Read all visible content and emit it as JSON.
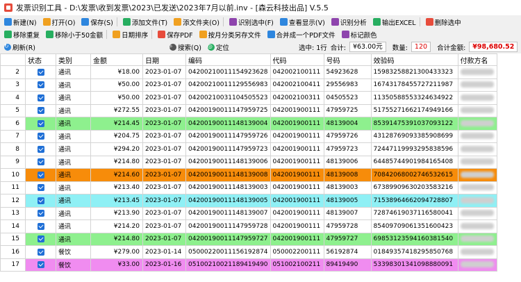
{
  "window": {
    "title": "发票识别工具 - D:\\发票\\收到发票\\2023\\已发送\\2023年7月以前.inv - [森云科技出品] V.5.5"
  },
  "toolbar1": [
    {
      "label": "新建(N)",
      "icon": "new-icon",
      "color": "#2e86de"
    },
    {
      "label": "打开(O)",
      "icon": "folder-open-icon",
      "color": "#f0a020"
    },
    {
      "label": "保存(S)",
      "icon": "save-icon",
      "color": "#2e86de"
    },
    {
      "label": "添加文件(T)",
      "icon": "add-file-icon",
      "color": "#27ae60"
    },
    {
      "label": "添文件夹(O)",
      "icon": "add-folder-icon",
      "color": "#f0a020"
    },
    {
      "label": "识别选中(F)",
      "icon": "recognize-icon",
      "color": "#8e44ad"
    },
    {
      "label": "查看显示(V)",
      "icon": "view-icon",
      "color": "#2e86de"
    },
    {
      "label": "识别分析",
      "icon": "analyze-icon",
      "color": "#8e44ad"
    },
    {
      "label": "输出EXCEL",
      "icon": "excel-icon",
      "color": "#27ae60"
    },
    {
      "label": "删除选中",
      "icon": "delete-icon",
      "color": "#e74c3c"
    }
  ],
  "toolbar2": [
    {
      "label": "移除重复",
      "icon": "remove-duplicates-icon",
      "color": "#27ae60"
    },
    {
      "label": "移除小于50金额",
      "icon": "remove-small-icon",
      "color": "#27ae60"
    },
    {
      "label": "日期排序",
      "icon": "date-sort-icon",
      "color": "#f0a020"
    },
    {
      "label": "保存PDF",
      "icon": "pdf-icon",
      "color": "#e74c3c"
    },
    {
      "label": "按月分类另存文件",
      "icon": "monthly-save-icon",
      "color": "#f0a020"
    },
    {
      "label": "合并成一个PDF文件",
      "icon": "merge-pdf-icon",
      "color": "#2e86de"
    },
    {
      "label": "标记颜色",
      "icon": "color-mark-icon",
      "color": "#8e44ad"
    }
  ],
  "statusbar": {
    "refresh": "刷新(R)",
    "search": "搜索(Q)",
    "locate": "定位",
    "selected": "选中: 1行",
    "total_label": "合计:",
    "total_value": "¥63.00元",
    "count_label": "数量:",
    "count_value": "120",
    "sum_label": "合计金额:",
    "sum_value": "¥98,680.52"
  },
  "table": {
    "columns": [
      "",
      "状态",
      "类别",
      "金额",
      "日期",
      "编码",
      "代码",
      "号码",
      "效验码",
      "付款方名"
    ],
    "rows": [
      {
        "index": "2",
        "category": "通讯",
        "amount": "¥18.00",
        "date": "2023-01-07",
        "code": "042002100111549236​28",
        "daima": "042002100111",
        "haoma": "54923628",
        "check": "15983258821300433323",
        "color": ""
      },
      {
        "index": "3",
        "category": "通讯",
        "amount": "¥50.00",
        "date": "2023-01-07",
        "code": "04200210011129556983",
        "daima": "042002100411",
        "haoma": "29556983",
        "check": "16743178455727211987",
        "color": ""
      },
      {
        "index": "4",
        "category": "通讯",
        "amount": "¥50.00",
        "date": "2023-01-07",
        "code": "04200210031104505523",
        "daima": "042002100311",
        "haoma": "04505523",
        "check": "11350588553324634922",
        "color": ""
      },
      {
        "index": "5",
        "category": "通讯",
        "amount": "¥272.55",
        "date": "2023-01-07",
        "code": "04200190011147959725",
        "daima": "042001900111",
        "haoma": "47959725",
        "check": "51755271662174949166",
        "color": ""
      },
      {
        "index": "6",
        "category": "通讯",
        "amount": "¥214.45",
        "date": "2023-01-07",
        "code": "04200190011148139004",
        "daima": "042001900111",
        "haoma": "48139004",
        "check": "85391475391037093122",
        "color": "#8ef08e"
      },
      {
        "index": "7",
        "category": "通讯",
        "amount": "¥204.75",
        "date": "2023-01-07",
        "code": "04200190011147959726",
        "daima": "042001900111",
        "haoma": "47959726",
        "check": "43128769093385908699",
        "color": ""
      },
      {
        "index": "8",
        "category": "通讯",
        "amount": "¥294.20",
        "date": "2023-01-07",
        "code": "04200190011147959723",
        "daima": "042001900111",
        "haoma": "47959723",
        "check": "72447119993295838596",
        "color": ""
      },
      {
        "index": "9",
        "category": "通讯",
        "amount": "¥214.80",
        "date": "2023-01-07",
        "code": "04200190011148139006",
        "daima": "042001900111",
        "haoma": "48139006",
        "check": "64485744901984165408",
        "color": ""
      },
      {
        "index": "10",
        "category": "通讯",
        "amount": "¥214.60",
        "date": "2023-01-07",
        "code": "04200190011148139008",
        "daima": "042001900111",
        "haoma": "48139008",
        "check": "70842068002746532615",
        "color": "#f78c0a"
      },
      {
        "index": "11",
        "category": "通讯",
        "amount": "¥213.40",
        "date": "2023-01-07",
        "code": "04200190011148139003",
        "daima": "042001900111",
        "haoma": "48139003",
        "check": "67389909630203583216",
        "color": ""
      },
      {
        "index": "12",
        "category": "通讯",
        "amount": "¥213.45",
        "date": "2023-01-07",
        "code": "04200190011148139005",
        "daima": "042001900111",
        "haoma": "48139005",
        "check": "71538964662094728807",
        "color": "#8ff0f5"
      },
      {
        "index": "13",
        "category": "通讯",
        "amount": "¥213.90",
        "date": "2023-01-07",
        "code": "04200190011148139007",
        "daima": "042001900111",
        "haoma": "48139007",
        "check": "72874619037116580041",
        "color": ""
      },
      {
        "index": "14",
        "category": "通讯",
        "amount": "¥214.20",
        "date": "2023-01-07",
        "code": "04200190011147959728",
        "daima": "042001900111",
        "haoma": "47959728",
        "check": "85409709061351600423",
        "color": ""
      },
      {
        "index": "15",
        "category": "通讯",
        "amount": "¥214.80",
        "date": "2023-01-07",
        "code": "04200190011147959727",
        "daima": "042001900111",
        "haoma": "47959727",
        "check": "69853123594160381540",
        "color": "#8ef08e"
      },
      {
        "index": "16",
        "category": "餐饮",
        "amount": "¥279.00",
        "date": "2023-01-14",
        "code": "05000220011156192874",
        "daima": "050002200111",
        "haoma": "56192874",
        "check": "01849357418295850768",
        "color": ""
      },
      {
        "index": "17",
        "category": "餐饮",
        "amount": "¥33.00",
        "date": "2023-01-16",
        "code": "05100210021189419490",
        "daima": "051002100211",
        "haoma": "89419490",
        "check": "53398301341098880091",
        "color": "#f08cf0"
      }
    ]
  }
}
